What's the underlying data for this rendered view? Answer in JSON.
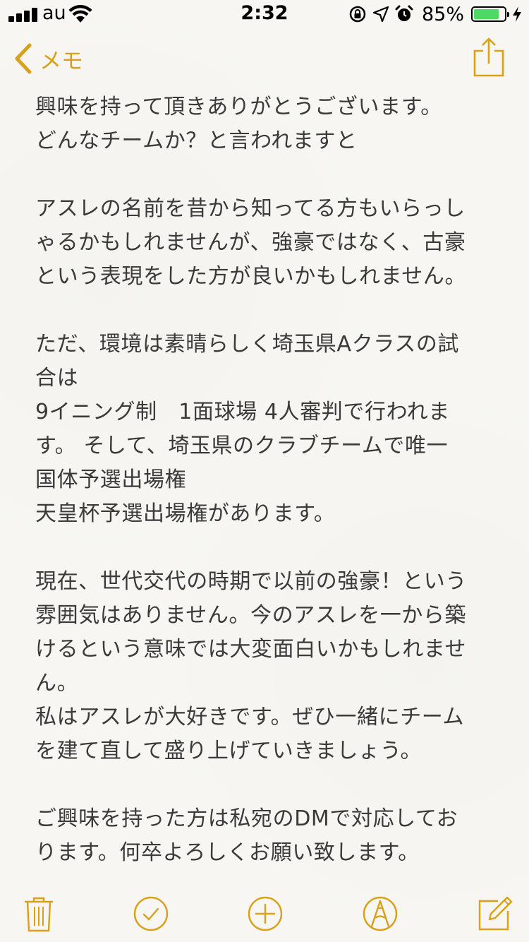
{
  "status_bar": {
    "carrier": "au",
    "time": "2:32",
    "battery_percent": "85%",
    "battery_level": 0.85,
    "battery_color": "#4cd964"
  },
  "nav": {
    "back_label": "メモ",
    "back_icon": "chevron-left-icon",
    "share_icon": "share-icon",
    "accent_color": "#d9a019"
  },
  "note": {
    "lines": [
      "興味を持って頂きありがとうございます。",
      "どんなチームか？と言われますと",
      "",
      "アスレの名前を昔から知ってる方もいらっし",
      "ゃるかもしれませんが、強豪ではなく、古豪",
      "という表現をした方が良いかもしれません。",
      "",
      "ただ、環境は素晴らしく埼玉県Aクラスの試",
      "合は",
      "9イニング制　1面球場  4人審判で行われま",
      "す。  そして、埼玉県のクラブチームで唯一",
      "国体予選出場権",
      "天皇杯予選出場権があります。",
      "",
      "現在、世代交代の時期で以前の強豪！という",
      "雰囲気はありません。今のアスレを一から築",
      "けるという意味では大変面白いかもしれませ",
      "ん。",
      "私はアスレが大好きです。ぜひ一緒にチーム",
      "を建て直して盛り上げていきましょう。",
      "",
      "ご興味を持った方は私宛のDMで対応してお",
      "ります。何卒よろしくお願い致します。"
    ]
  },
  "toolbar": {
    "icons": [
      "trash-icon",
      "checklist-icon",
      "add-icon",
      "sketch-icon",
      "compose-icon"
    ]
  }
}
